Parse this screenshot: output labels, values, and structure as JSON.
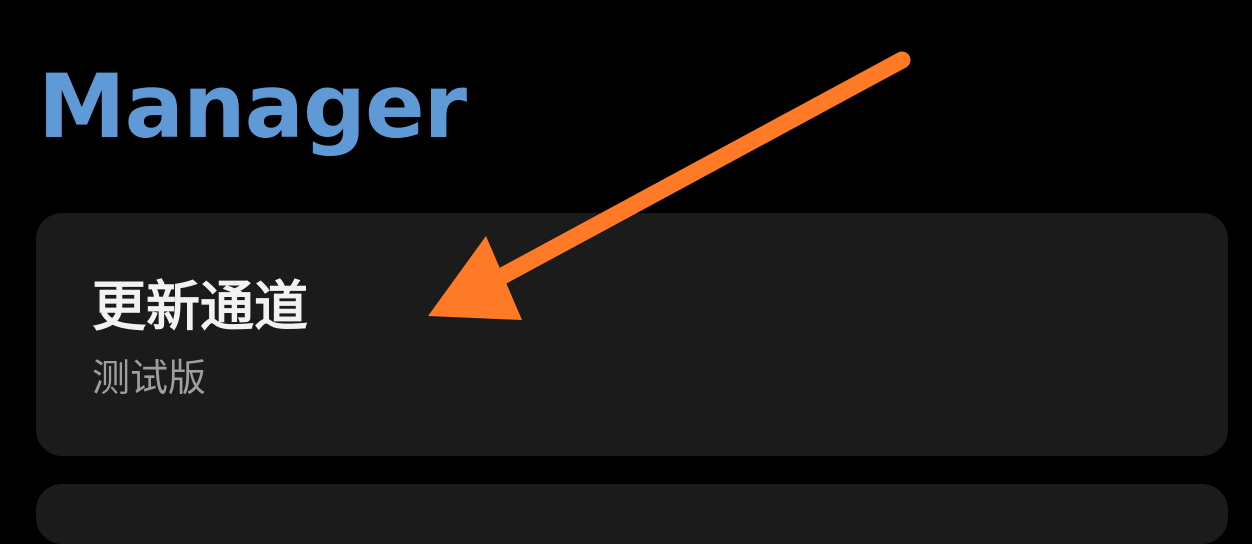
{
  "colors": {
    "background": "#000000",
    "section_title": "#5f9ad7",
    "card_background": "#1b1b1b",
    "card_title": "#f2f2f2",
    "card_subtitle": "#9e9e9e",
    "annotation_arrow": "#ff7a26"
  },
  "section": {
    "title": "Manager"
  },
  "settings": {
    "update_channel": {
      "title": "更新通道",
      "value": "测试版"
    }
  },
  "annotation": {
    "icon": "arrow-annotation-icon"
  }
}
